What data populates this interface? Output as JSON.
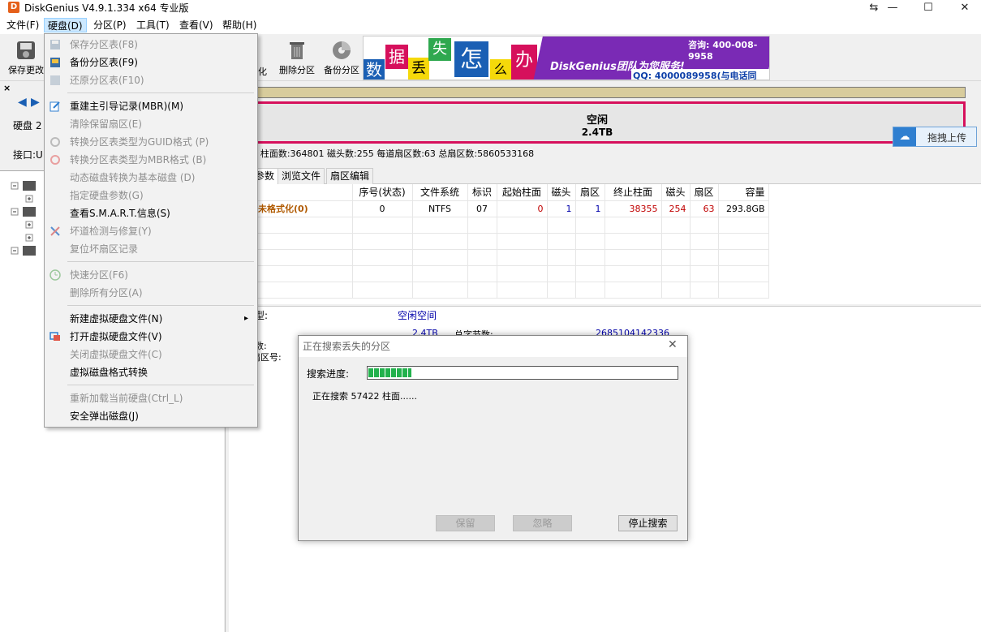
{
  "window": {
    "title": "DiskGenius V4.9.1.334 x64 专业版",
    "minimize": "—",
    "maximize": "☐",
    "close": "✕",
    "restore": "⇆"
  },
  "menubar": [
    "文件(F)",
    "硬盘(D)",
    "分区(P)",
    "工具(T)",
    "查看(V)",
    "帮助(H)"
  ],
  "toolbar": {
    "save": "保存更改",
    "delete_partition": "删除分区",
    "backup_partition": "备份分区",
    "partial_label": "化"
  },
  "banner": {
    "chars": [
      "数",
      "据",
      "丢",
      "失",
      "怎",
      "么",
      "办"
    ],
    "team": "DiskGenius团队为您服务!",
    "phone": "咨询: 400-008-9958",
    "qq": "QQ: 4000089958(与电话同号)"
  },
  "left_panel": {
    "disk_label": "硬盘 2",
    "interface_label": "接口:U"
  },
  "diskmap": {
    "free_label": "空闲",
    "free_size": "2.4TB",
    "upload_label": "拖拽上传"
  },
  "disk_info": "88MB)  柱面数:364801  磁头数:255  每道扇区数:63  总扇区数:5860533168",
  "tabs": [
    "参数",
    "浏览文件",
    "扇区编辑"
  ],
  "table": {
    "headers": [
      "",
      "序号(状态)",
      "文件系统",
      "标识",
      "起始柱面",
      "磁头",
      "扇区",
      "终止柱面",
      "磁头",
      "扇区",
      "容量"
    ],
    "rows": [
      {
        "name": "未格式化(0)",
        "index": "0",
        "fs": "NTFS",
        "id": "07",
        "start_cyl": "0",
        "start_head": "1",
        "start_sec": "1",
        "end_cyl": "38355",
        "end_head": "254",
        "end_sec": "63",
        "size": "293.8GB"
      }
    ]
  },
  "bottom": {
    "type_label": "型:",
    "type_value": "空闲空间",
    "size_label": ":",
    "size_value": "2.4TB",
    "bytes_label": "总字节数:",
    "bytes_value": "2685104142336",
    "sectors_label": "数:",
    "start_label": "扇区号:"
  },
  "dropdown": [
    {
      "label": "保存分区表(F8)",
      "disabled": true,
      "icon": "save-icon"
    },
    {
      "label": "备份分区表(F9)",
      "disabled": false,
      "icon": "backup-icon"
    },
    {
      "label": "还原分区表(F10)",
      "disabled": true,
      "icon": "restore-icon"
    },
    {
      "label": "重建主引导记录(MBR)(M)",
      "disabled": false,
      "icon": "edit-icon"
    },
    {
      "label": "清除保留扇区(E)",
      "disabled": true,
      "icon": ""
    },
    {
      "label": "转换分区表类型为GUID格式 (P)",
      "disabled": true,
      "icon": "convert-icon"
    },
    {
      "label": "转换分区表类型为MBR格式 (B)",
      "disabled": true,
      "icon": "convert-icon"
    },
    {
      "label": "动态磁盘转换为基本磁盘 (D)",
      "disabled": true,
      "icon": ""
    },
    {
      "label": "指定硬盘参数(G)",
      "disabled": true,
      "icon": ""
    },
    {
      "label": "查看S.M.A.R.T.信息(S)",
      "disabled": false,
      "icon": ""
    },
    {
      "label": "坏道检测与修复(Y)",
      "disabled": true,
      "icon": "tools-icon"
    },
    {
      "label": "复位坏扇区记录",
      "disabled": true,
      "icon": ""
    },
    {
      "label": "快速分区(F6)",
      "disabled": true,
      "icon": "clock-icon"
    },
    {
      "label": "删除所有分区(A)",
      "disabled": true,
      "icon": ""
    },
    {
      "label": "新建虚拟硬盘文件(N)",
      "disabled": false,
      "icon": "",
      "submenu": "▸"
    },
    {
      "label": "打开虚拟硬盘文件(V)",
      "disabled": false,
      "icon": "virtual-disk-icon"
    },
    {
      "label": "关闭虚拟硬盘文件(C)",
      "disabled": true,
      "icon": ""
    },
    {
      "label": "虚拟磁盘格式转换",
      "disabled": false,
      "icon": ""
    },
    {
      "label": "重新加载当前硬盘(Ctrl_L)",
      "disabled": true,
      "icon": ""
    },
    {
      "label": "安全弹出磁盘(J)",
      "disabled": false,
      "icon": ""
    }
  ],
  "dialog": {
    "title": "正在搜索丢失的分区",
    "progress_label": "搜索进度:",
    "progress_fraction": 0.14,
    "status": "正在搜索 57422 柱面......",
    "keep": "保留",
    "ignore": "忽略",
    "stop": "停止搜索",
    "close": "✕"
  },
  "colors": {
    "accent": "#d6105c",
    "progress": "#22b14c",
    "title": "#000000",
    "link": "#0000aa"
  }
}
